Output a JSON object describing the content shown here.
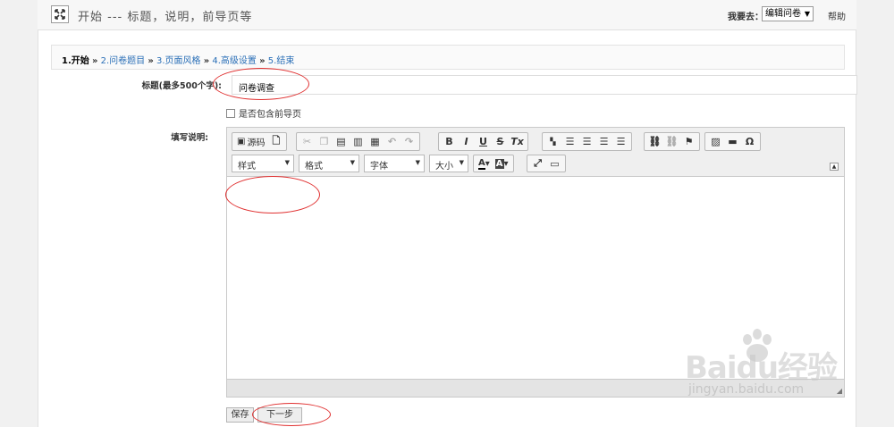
{
  "header": {
    "heading": "开始 --- 标题，说明，前导页等",
    "goto_label": "我要去：",
    "goto_selected": "编辑问卷",
    "help_label": "帮助"
  },
  "breadcrumb": {
    "current": "1.开始",
    "steps": [
      "2.问卷题目",
      "3.页面风格",
      "4.高级设置",
      "5.结束"
    ],
    "separator": "»"
  },
  "form": {
    "title_label": "标题(最多500个字):",
    "title_value": "问卷调查",
    "include_intro_label": "是否包含前导页",
    "include_intro_checked": false,
    "description_label": "填写说明:"
  },
  "editor": {
    "source_label": "源码",
    "style_combo": "样式",
    "format_combo": "格式",
    "font_combo": "字体",
    "size_combo": "大小",
    "bold": "B",
    "italic": "I",
    "underline": "U",
    "strike": "S",
    "removeformat": "Tx",
    "special_char": "Ω",
    "content": ""
  },
  "buttons": {
    "save": "保存",
    "next": "下一步"
  },
  "watermark": {
    "logo": "Baidu经验",
    "url": "jingyan.baidu.com"
  },
  "colors": {
    "annotation": "#e03030",
    "link": "#2a6fb7"
  }
}
